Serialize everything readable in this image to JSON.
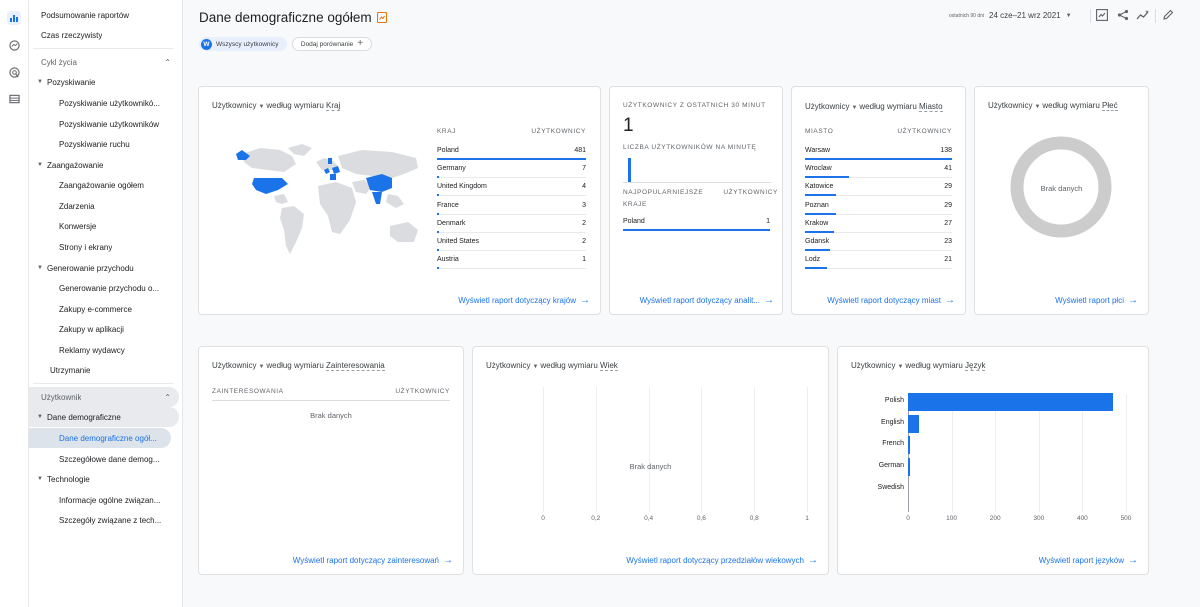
{
  "header": {
    "title": "Dane demograficzne ogółem",
    "chip_user_initial": "W",
    "chip_user_label": "Wszyscy użytkownicy",
    "add_compare_label": "Dodaj porównanie",
    "date_prefix": "ostatnich 90 dni",
    "date_range": "24 cze–21 wrz 2021"
  },
  "nav": {
    "top1": "Podsumowanie raportów",
    "top2": "Czas rzeczywisty",
    "sec1": "Cykl życia",
    "g1": "Pozyskiwanie",
    "g1a": "Pozyskiwanie użytkownikó...",
    "g1b": "Pozyskiwanie użytkowników",
    "g1c": "Pozyskiwanie ruchu",
    "g2": "Zaangażowanie",
    "g2a": "Zaangażowanie ogółem",
    "g2b": "Zdarzenia",
    "g2c": "Konwersje",
    "g2d": "Strony i ekrany",
    "g3": "Generowanie przychodu",
    "g3a": "Generowanie przychodu o...",
    "g3b": "Zakupy e-commerce",
    "g3c": "Zakupy w aplikacji",
    "g3d": "Reklamy wydawcy",
    "g4": "Utrzymanie",
    "sec2": "Użytkownik",
    "g5": "Dane demograficzne",
    "g5a": "Dane demograficzne ogół...",
    "g5b": "Szczegółowe dane demog...",
    "g6": "Technologie",
    "g6a": "Informacje ogólne związan...",
    "g6b": "Szczegóły związane z tech..."
  },
  "cards": {
    "metric": "Użytkownicy",
    "by_dim": "według wymiaru",
    "country": {
      "dim": "Kraj",
      "col1": "KRAJ",
      "col2": "UŻYTKOWNICY",
      "rows": [
        {
          "name": "Poland",
          "value": "481"
        },
        {
          "name": "Germany",
          "value": "7"
        },
        {
          "name": "United Kingdom",
          "value": "4"
        },
        {
          "name": "France",
          "value": "3"
        },
        {
          "name": "Denmark",
          "value": "2"
        },
        {
          "name": "United States",
          "value": "2"
        },
        {
          "name": "Austria",
          "value": "1"
        }
      ],
      "link": "Wyświetl raport dotyczący krajów"
    },
    "realtime": {
      "heading": "UŻYTKOWNICY Z OSTATNICH 30 MINUT",
      "value": "1",
      "per_minute": "LICZBA UŻYTKOWNIKÓW NA MINUTĘ",
      "top_label_1": "NAJPOPULARNIEJSZE",
      "top_label_2": "KRAJE",
      "top_col2": "UŻYTKOWNICY",
      "rows": [
        {
          "name": "Poland",
          "value": "1"
        }
      ],
      "link": "Wyświetl raport dotyczący analit..."
    },
    "city": {
      "dim": "Miasto",
      "col1": "MIASTO",
      "col2": "UŻYTKOWNICY",
      "rows": [
        {
          "name": "Warsaw",
          "value": "138"
        },
        {
          "name": "Wroclaw",
          "value": "41"
        },
        {
          "name": "Katowice",
          "value": "29"
        },
        {
          "name": "Poznan",
          "value": "29"
        },
        {
          "name": "Krakow",
          "value": "27"
        },
        {
          "name": "Gdansk",
          "value": "23"
        },
        {
          "name": "Lodz",
          "value": "21"
        }
      ],
      "link": "Wyświetl raport dotyczący miast"
    },
    "gender": {
      "dim": "Płeć",
      "no_data": "Brak danych",
      "link": "Wyświetl raport płci"
    },
    "interests": {
      "dim": "Zainteresowania",
      "col1": "ZAINTERESOWANIA",
      "col2": "UŻYTKOWNICY",
      "no_data": "Brak danych",
      "link": "Wyświetl raport dotyczący zainteresowań"
    },
    "age": {
      "dim": "Wiek",
      "no_data": "Brak danych",
      "ticks": [
        "0",
        "0,2",
        "0,4",
        "0,6",
        "0,8",
        "1"
      ],
      "link": "Wyświetl raport dotyczący przedziałów wiekowych"
    },
    "language": {
      "dim": "Język",
      "categories": [
        "Polish",
        "English",
        "French",
        "German",
        "Swedish"
      ],
      "values": [
        470,
        25,
        3,
        2,
        0
      ],
      "ticks": [
        "0",
        "100",
        "200",
        "300",
        "400",
        "500"
      ],
      "link": "Wyświetl raport języków"
    }
  }
}
